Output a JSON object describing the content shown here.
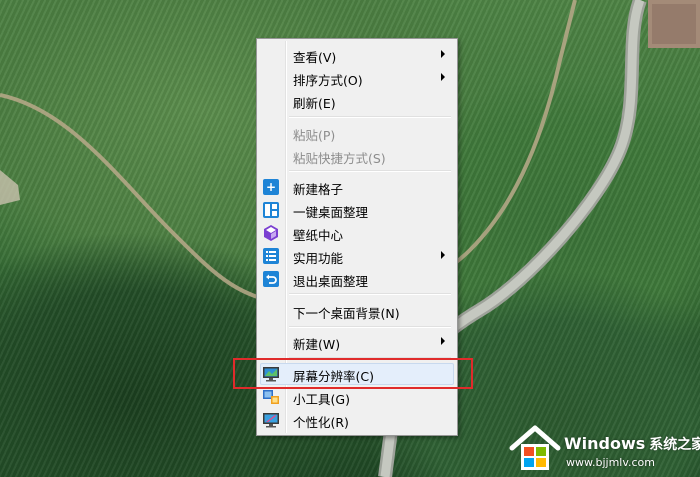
{
  "menu": {
    "items": [
      {
        "label": "查看(V)",
        "submenu": true,
        "enabled": true
      },
      {
        "label": "排序方式(O)",
        "submenu": true,
        "enabled": true
      },
      {
        "label": "刷新(E)",
        "submenu": false,
        "enabled": true
      },
      {
        "label": "粘贴(P)",
        "submenu": false,
        "enabled": false
      },
      {
        "label": "粘贴快捷方式(S)",
        "submenu": false,
        "enabled": false
      },
      {
        "label": "新建格子",
        "icon": "plus-icon",
        "enabled": true
      },
      {
        "label": "一键桌面整理",
        "icon": "layout-icon",
        "enabled": true
      },
      {
        "label": "壁纸中心",
        "icon": "cube-icon",
        "enabled": true
      },
      {
        "label": "实用功能",
        "icon": "list-icon",
        "submenu": true,
        "enabled": true
      },
      {
        "label": "退出桌面整理",
        "icon": "undo-icon",
        "enabled": true
      },
      {
        "label": "下一个桌面背景(N)",
        "enabled": true
      },
      {
        "label": "新建(W)",
        "submenu": true,
        "enabled": true
      },
      {
        "label": "屏幕分辨率(C)",
        "icon": "monitor-icon",
        "enabled": true,
        "highlighted": true
      },
      {
        "label": "小工具(G)",
        "icon": "gadgets-icon",
        "enabled": true
      },
      {
        "label": "个性化(R)",
        "icon": "personalize-icon",
        "enabled": true
      }
    ]
  },
  "watermark": {
    "brand": "Windows",
    "brand_cn": "系统之家",
    "url": "www.bjjmlv.com"
  },
  "colors": {
    "annotation": "#e02b2b",
    "icon_blue": "#1e84d6",
    "menu_bg": "#f0f0f0"
  }
}
